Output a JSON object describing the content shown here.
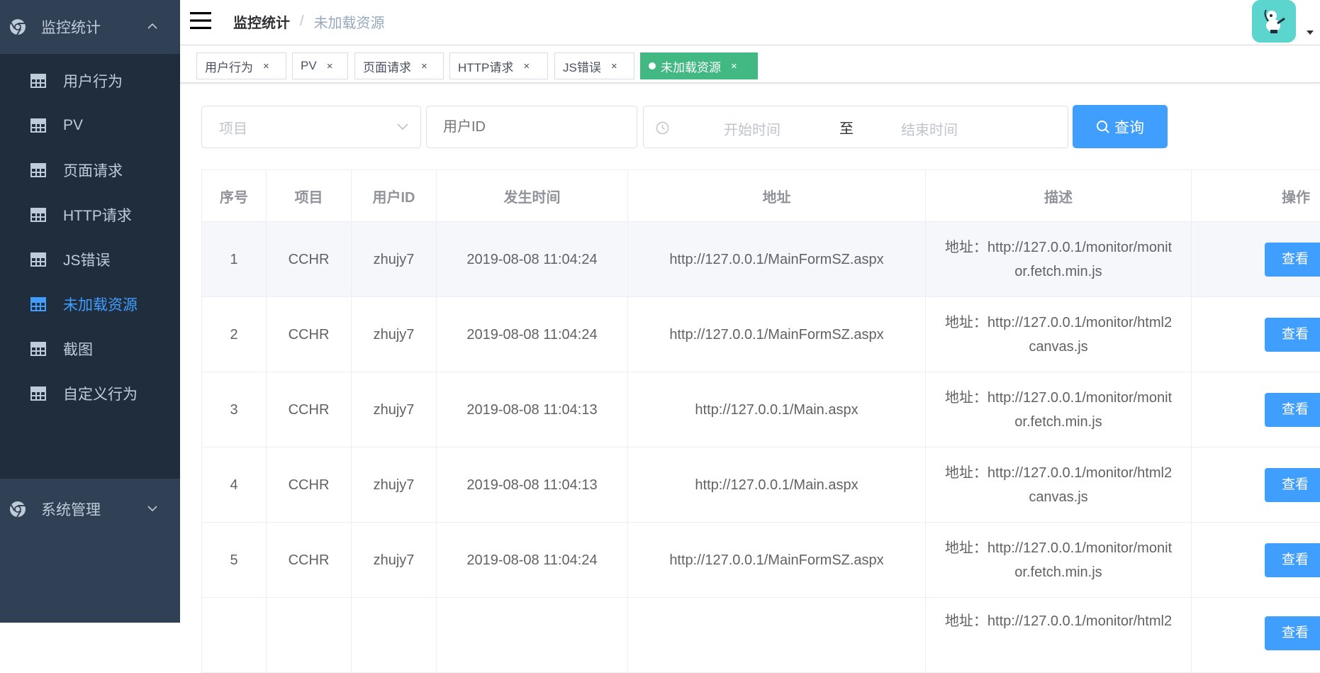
{
  "sidebar": {
    "group1": {
      "label": "监控统计",
      "icon": "chrome-icon",
      "expanded": true
    },
    "items": [
      {
        "label": "用户行为",
        "icon": "grid-icon",
        "active": false
      },
      {
        "label": "PV",
        "icon": "grid-icon",
        "active": false
      },
      {
        "label": "页面请求",
        "icon": "grid-icon",
        "active": false
      },
      {
        "label": "HTTP请求",
        "icon": "grid-icon",
        "active": false
      },
      {
        "label": "JS错误",
        "icon": "grid-icon",
        "active": false
      },
      {
        "label": "未加载资源",
        "icon": "grid-icon",
        "active": true
      },
      {
        "label": "截图",
        "icon": "grid-icon",
        "active": false
      },
      {
        "label": "自定义行为",
        "icon": "grid-icon",
        "active": false
      }
    ],
    "group2": {
      "label": "系统管理",
      "icon": "chrome-icon",
      "expanded": false
    }
  },
  "navbar": {
    "breadcrumb": [
      "监控统计",
      "未加载资源"
    ],
    "separator": "/"
  },
  "tags": [
    {
      "label": "用户行为",
      "close": "×",
      "active": false
    },
    {
      "label": "PV",
      "close": "×",
      "active": false
    },
    {
      "label": "页面请求",
      "close": "×",
      "active": false
    },
    {
      "label": "HTTP请求",
      "close": "×",
      "active": false
    },
    {
      "label": "JS错误",
      "close": "×",
      "active": false
    },
    {
      "label": "未加载资源",
      "close": "×",
      "active": true
    }
  ],
  "filter": {
    "project_placeholder": "项目",
    "userid_placeholder": "用户ID",
    "start_placeholder": "开始时间",
    "range_separator": "至",
    "end_placeholder": "结束时间",
    "query_label": "查询"
  },
  "table": {
    "columns": [
      "序号",
      "项目",
      "用户ID",
      "发生时间",
      "地址",
      "描述",
      "操作"
    ],
    "action_label": "查看",
    "rows": [
      {
        "no": "1",
        "project": "CCHR",
        "user": "zhujy7",
        "time": "2019-08-08 11:04:24",
        "url": "http://127.0.0.1/MainFormSZ.aspx",
        "desc1": "地址：http://127.0.0.1/monitor/monit",
        "desc2": "or.fetch.min.js"
      },
      {
        "no": "2",
        "project": "CCHR",
        "user": "zhujy7",
        "time": "2019-08-08 11:04:24",
        "url": "http://127.0.0.1/MainFormSZ.aspx",
        "desc1": "地址：http://127.0.0.1/monitor/html2",
        "desc2": "canvas.js"
      },
      {
        "no": "3",
        "project": "CCHR",
        "user": "zhujy7",
        "time": "2019-08-08 11:04:13",
        "url": "http://127.0.0.1/Main.aspx",
        "desc1": "地址：http://127.0.0.1/monitor/monit",
        "desc2": "or.fetch.min.js"
      },
      {
        "no": "4",
        "project": "CCHR",
        "user": "zhujy7",
        "time": "2019-08-08 11:04:13",
        "url": "http://127.0.0.1/Main.aspx",
        "desc1": "地址：http://127.0.0.1/monitor/html2",
        "desc2": "canvas.js"
      },
      {
        "no": "5",
        "project": "CCHR",
        "user": "zhujy7",
        "time": "2019-08-08 11:04:24",
        "url": "http://127.0.0.1/MainFormSZ.aspx",
        "desc1": "地址：http://127.0.0.1/monitor/monit",
        "desc2": "or.fetch.min.js"
      },
      {
        "no": "",
        "project": "",
        "user": "",
        "time": "",
        "url": "",
        "desc1": "地址：http://127.0.0.1/monitor/html2",
        "desc2": ""
      }
    ]
  },
  "colors": {
    "sidebar": "#304156",
    "submenu": "#1f2d3d",
    "accent": "#409eff",
    "tag_active": "#42b983"
  }
}
